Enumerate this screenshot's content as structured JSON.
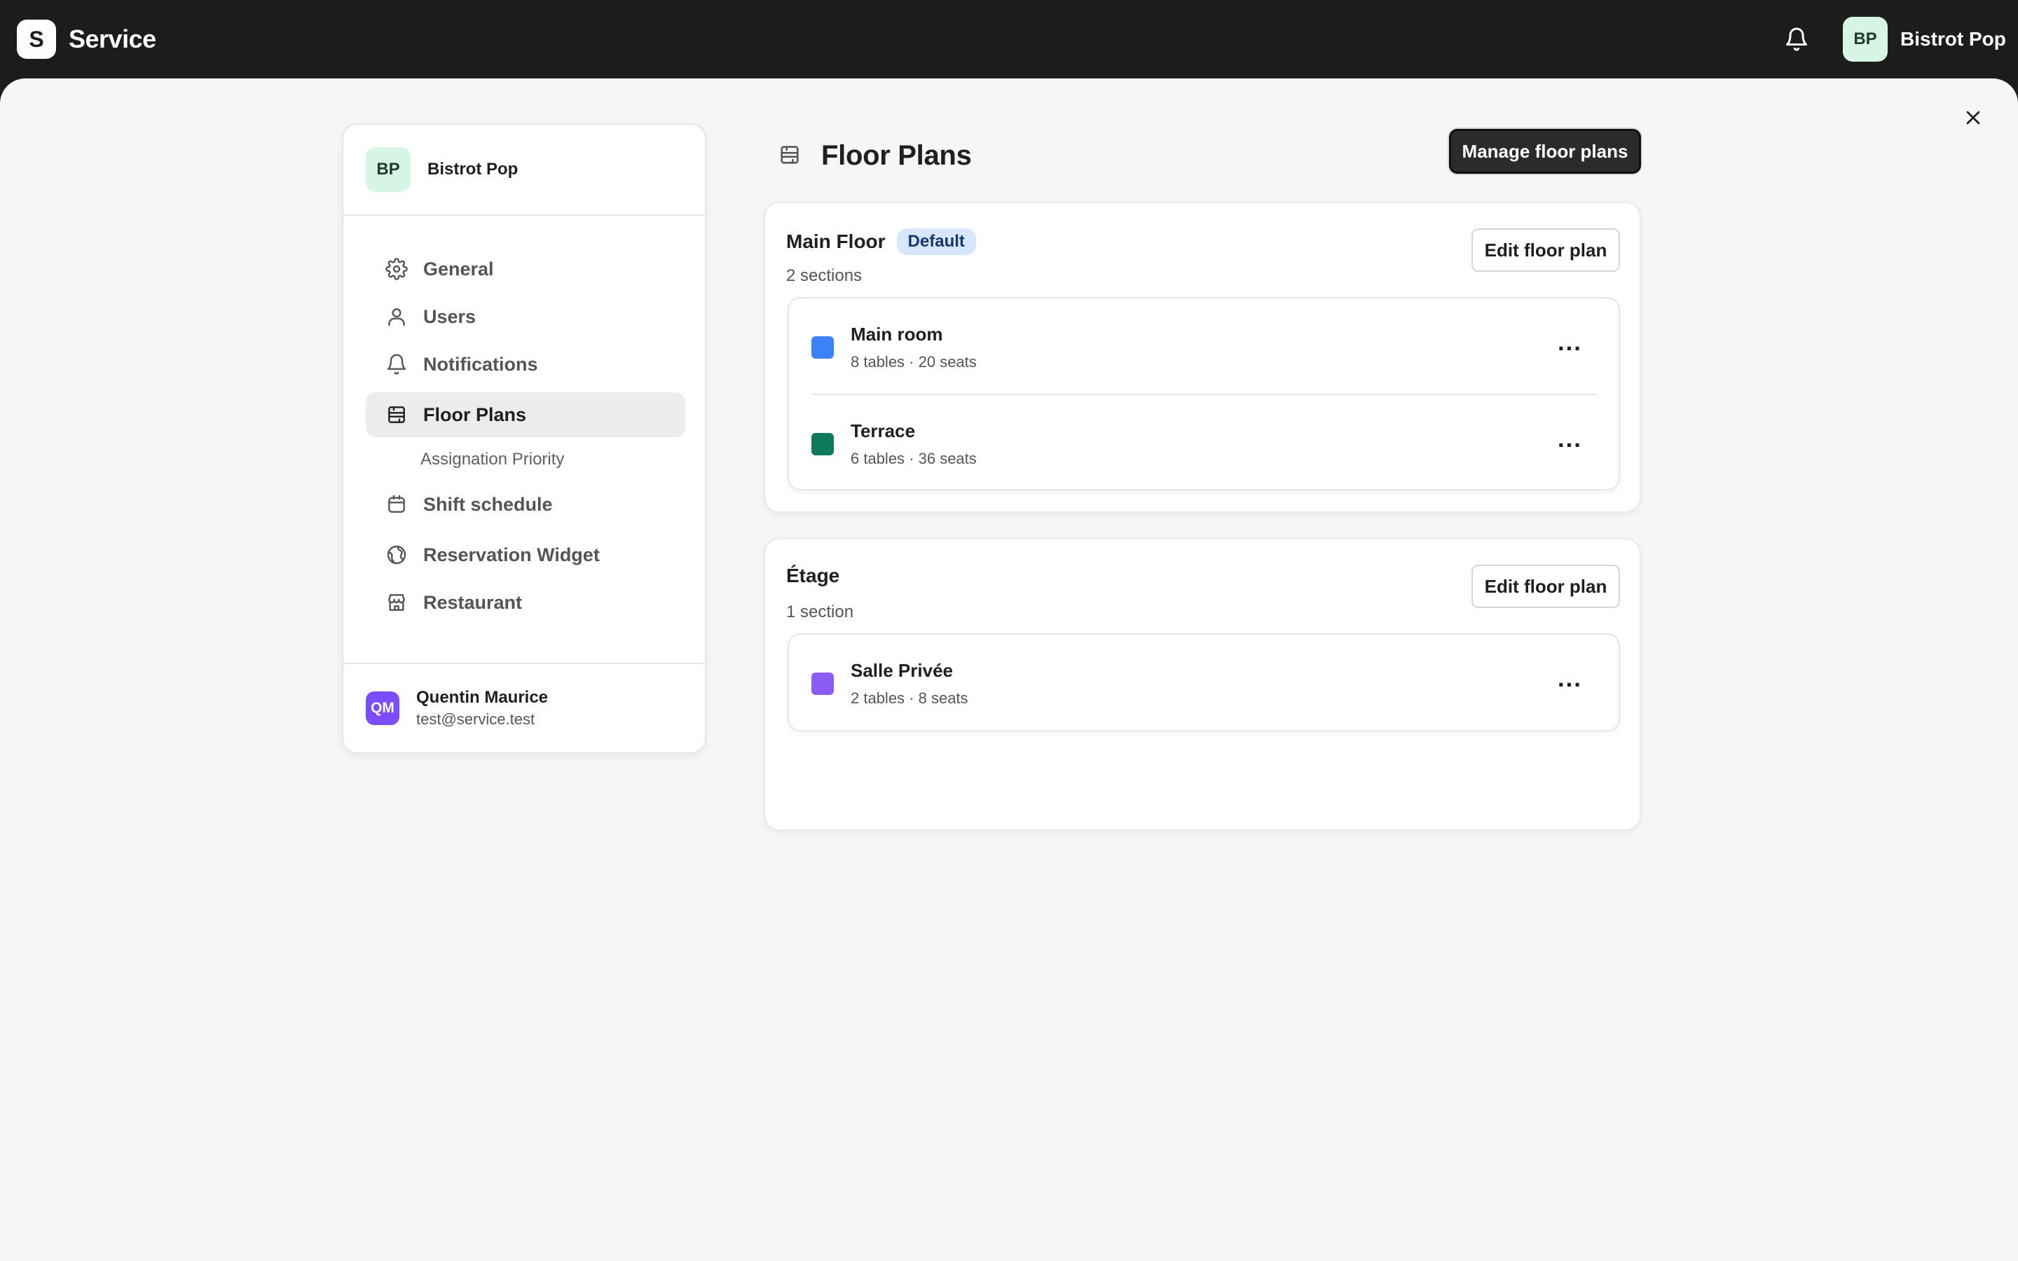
{
  "app": {
    "logo_letter": "S",
    "name": "Service"
  },
  "topbar": {
    "user_initials": "BP",
    "user_name": "Bistrot Pop",
    "bell_icon": "bell-icon"
  },
  "sidebar": {
    "org_initials": "BP",
    "org_name": "Bistrot Pop",
    "items": [
      {
        "label": "General",
        "icon": "gear-icon"
      },
      {
        "label": "Users",
        "icon": "user-icon"
      },
      {
        "label": "Notifications",
        "icon": "bell-icon"
      },
      {
        "label": "Floor Plans",
        "icon": "floor-plan-icon",
        "active": true
      },
      {
        "label": "Shift schedule",
        "icon": "calendar-icon"
      },
      {
        "label": "Reservation Widget",
        "icon": "globe-icon"
      },
      {
        "label": "Restaurant",
        "icon": "store-icon"
      }
    ],
    "sub_item": "Assignation Priority",
    "footer": {
      "initials": "QM",
      "name": "Quentin Maurice",
      "email": "test@service.test"
    }
  },
  "page": {
    "title": "Floor Plans",
    "manage_label": "Manage floor plans"
  },
  "floors": [
    {
      "name": "Main Floor",
      "badge": "Default",
      "count": "2 sections",
      "edit_label": "Edit floor plan",
      "sections": [
        {
          "name": "Main room",
          "meta": "8 tables · 20 seats",
          "color": "#3b82f6"
        },
        {
          "name": "Terrace",
          "meta": "6 tables · 36 seats",
          "color": "#0e7a5a"
        }
      ]
    },
    {
      "name": "Étage",
      "count": "1 section",
      "edit_label": "Edit floor plan",
      "sections": [
        {
          "name": "Salle Privée",
          "meta": "2 tables · 8 seats",
          "color": "#8b5cf6"
        }
      ]
    }
  ],
  "more_label": "···"
}
